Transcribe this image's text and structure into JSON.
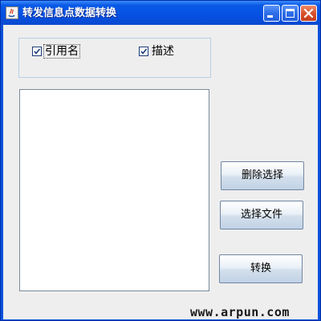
{
  "window": {
    "title": "转发信息点数据转换",
    "controls": {
      "minimize_icon": "minimize-icon",
      "maximize_icon": "maximize-icon",
      "close_icon": "close-icon"
    }
  },
  "options": {
    "checkboxes": [
      {
        "label": "引用名",
        "checked": true
      },
      {
        "label": "描述",
        "checked": true
      }
    ]
  },
  "list": {
    "items": []
  },
  "buttons": {
    "delete_selection": "删除选择",
    "choose_file": "选择文件",
    "convert": "转换"
  },
  "watermark": "www.arpun.com",
  "colors": {
    "titlebar": "#0650e2",
    "client_bg": "#eeeeee",
    "close_button": "#d9512d",
    "group_border": "#b8cfe5"
  }
}
